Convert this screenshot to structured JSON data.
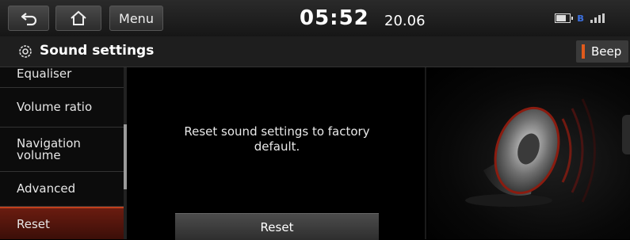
{
  "topbar": {
    "back_icon": "back-arrow-icon",
    "home_icon": "home-icon",
    "menu_label": "Menu",
    "time": "05:52",
    "date": "20.06"
  },
  "status_icons": [
    "battery-icon",
    "bluetooth-icon",
    "signal-icon"
  ],
  "titlebar": {
    "icon": "gear-icon",
    "title": "Sound settings",
    "beep_label": "Beep",
    "beep_indicator_color": "#e05a1c"
  },
  "sidemenu": {
    "items": [
      {
        "label": "Equaliser"
      },
      {
        "label": "Volume ratio"
      },
      {
        "label": "Navigation volume"
      },
      {
        "label": "Advanced"
      },
      {
        "label": "Reset",
        "selected": true
      }
    ]
  },
  "main": {
    "message": "Reset sound settings to factory default.",
    "reset_button_label": "Reset"
  },
  "colors": {
    "accent": "#e05a1c",
    "selected_item": "#6a1c10"
  }
}
